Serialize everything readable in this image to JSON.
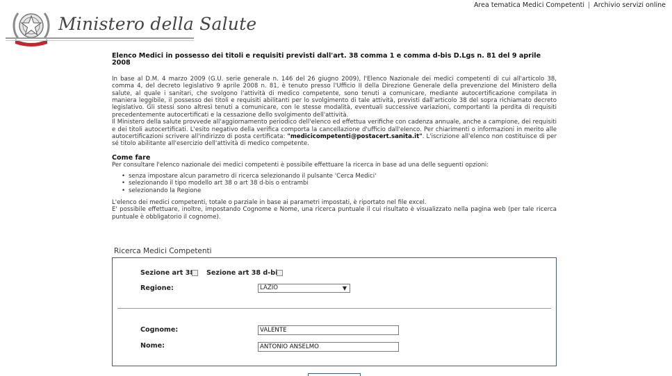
{
  "top_links": {
    "area_tematica": "Area tematica Medici Competenti",
    "separator": "|",
    "archivio": "Archivio servizi online"
  },
  "header": {
    "ministry_name": "Ministero della Salute",
    "emblem_icon": "italian-republic-emblem-icon"
  },
  "main": {
    "title": "Elenco Medici in possesso dei titoli e requisiti previsti dall'art. 38 comma 1 e comma d-bis D.Lgs n. 81 del 9 aprile 2008",
    "para1": "In base al D.M. 4 marzo 2009 (G.U. serie generale n. 146 del 26 giugno 2009), l'Elenco Nazionale dei medici competenti di cui all'articolo 38, comma 4, del decreto legislativo 9 aprile 2008 n. 81, è tenuto presso l'Ufficio II della Direzione Generale della prevenzione del Ministero della salute, al quale i sanitari, che svolgono l'attività di medico competente, sono tenuti a comunicare, mediante autocertificazione compilata in maniera leggibile, il possesso dei titoli e requisiti abilitanti per lo svolgimento di tale attività, previsti dall'articolo 38 del sopra richiamato decreto legislativo. Gli stessi sono altresì tenuti a comunicare, con le stesse modalità, eventuali successive variazioni, comportanti la perdita di requisiti precedentemente autocertificati e la cessazione dello svolgimento dell'attività.",
    "para2_a": "Il Ministero della salute provvede all'aggiornamento periodico dell'elenco ed effettua verifiche con cadenza annuale, anche a campione, dei requisiti e dei titoli autocertificati. L'esito negativo della verifica comporta la cancellazione d'ufficio dall'elenco. Per chiarimenti o informazioni in merito alle autocertificazioni scrivere all'indirizzo di posta certificata: ",
    "para2_email": "\"medicicompetenti@postacert.sanita.it\"",
    "para2_b": ". L'iscrizione all'elenco non costituisce di per sé titolo abilitante all'esercizio dell'attività di medico competente.",
    "come_fare_title": "Come fare",
    "come_fare_intro": "Per consultare l'elenco nazionale dei medici competenti è possibile effettuare la ricerca in base ad una delle seguenti opzioni:",
    "options": [
      "senza impostare alcun parametro di ricerca selezionando il pulsante 'Cerca Medici'",
      "selezionando il tipo modello art 38 o art 38 d-bis o entrambi",
      "selezionando la Regione"
    ],
    "para3": "L'elenco dei medici competenti, totale o parziale in base ai parametri impostati, è riportato nel file excel.",
    "para4": "E' possibile effettuare, inoltre, impostando Cognome e Nome, una ricerca puntuale il cui risultato è visualizzato nella pagina web (per tale ricerca puntuale è obbligatorio il cognome)."
  },
  "search": {
    "legend": "Ricerca Medici Competenti",
    "art38_label": "Sezione art 38",
    "art38dbis_label": "Sezione art 38 d-bis",
    "regione_label": "Regione:",
    "regione_value": "LAZIO",
    "cognome_label": "Cognome:",
    "cognome_value": "VALENTE",
    "nome_label": "Nome:",
    "nome_value": "ANTONIO ANSELMO"
  },
  "colors": {
    "panel_border": "#3b5a77"
  }
}
